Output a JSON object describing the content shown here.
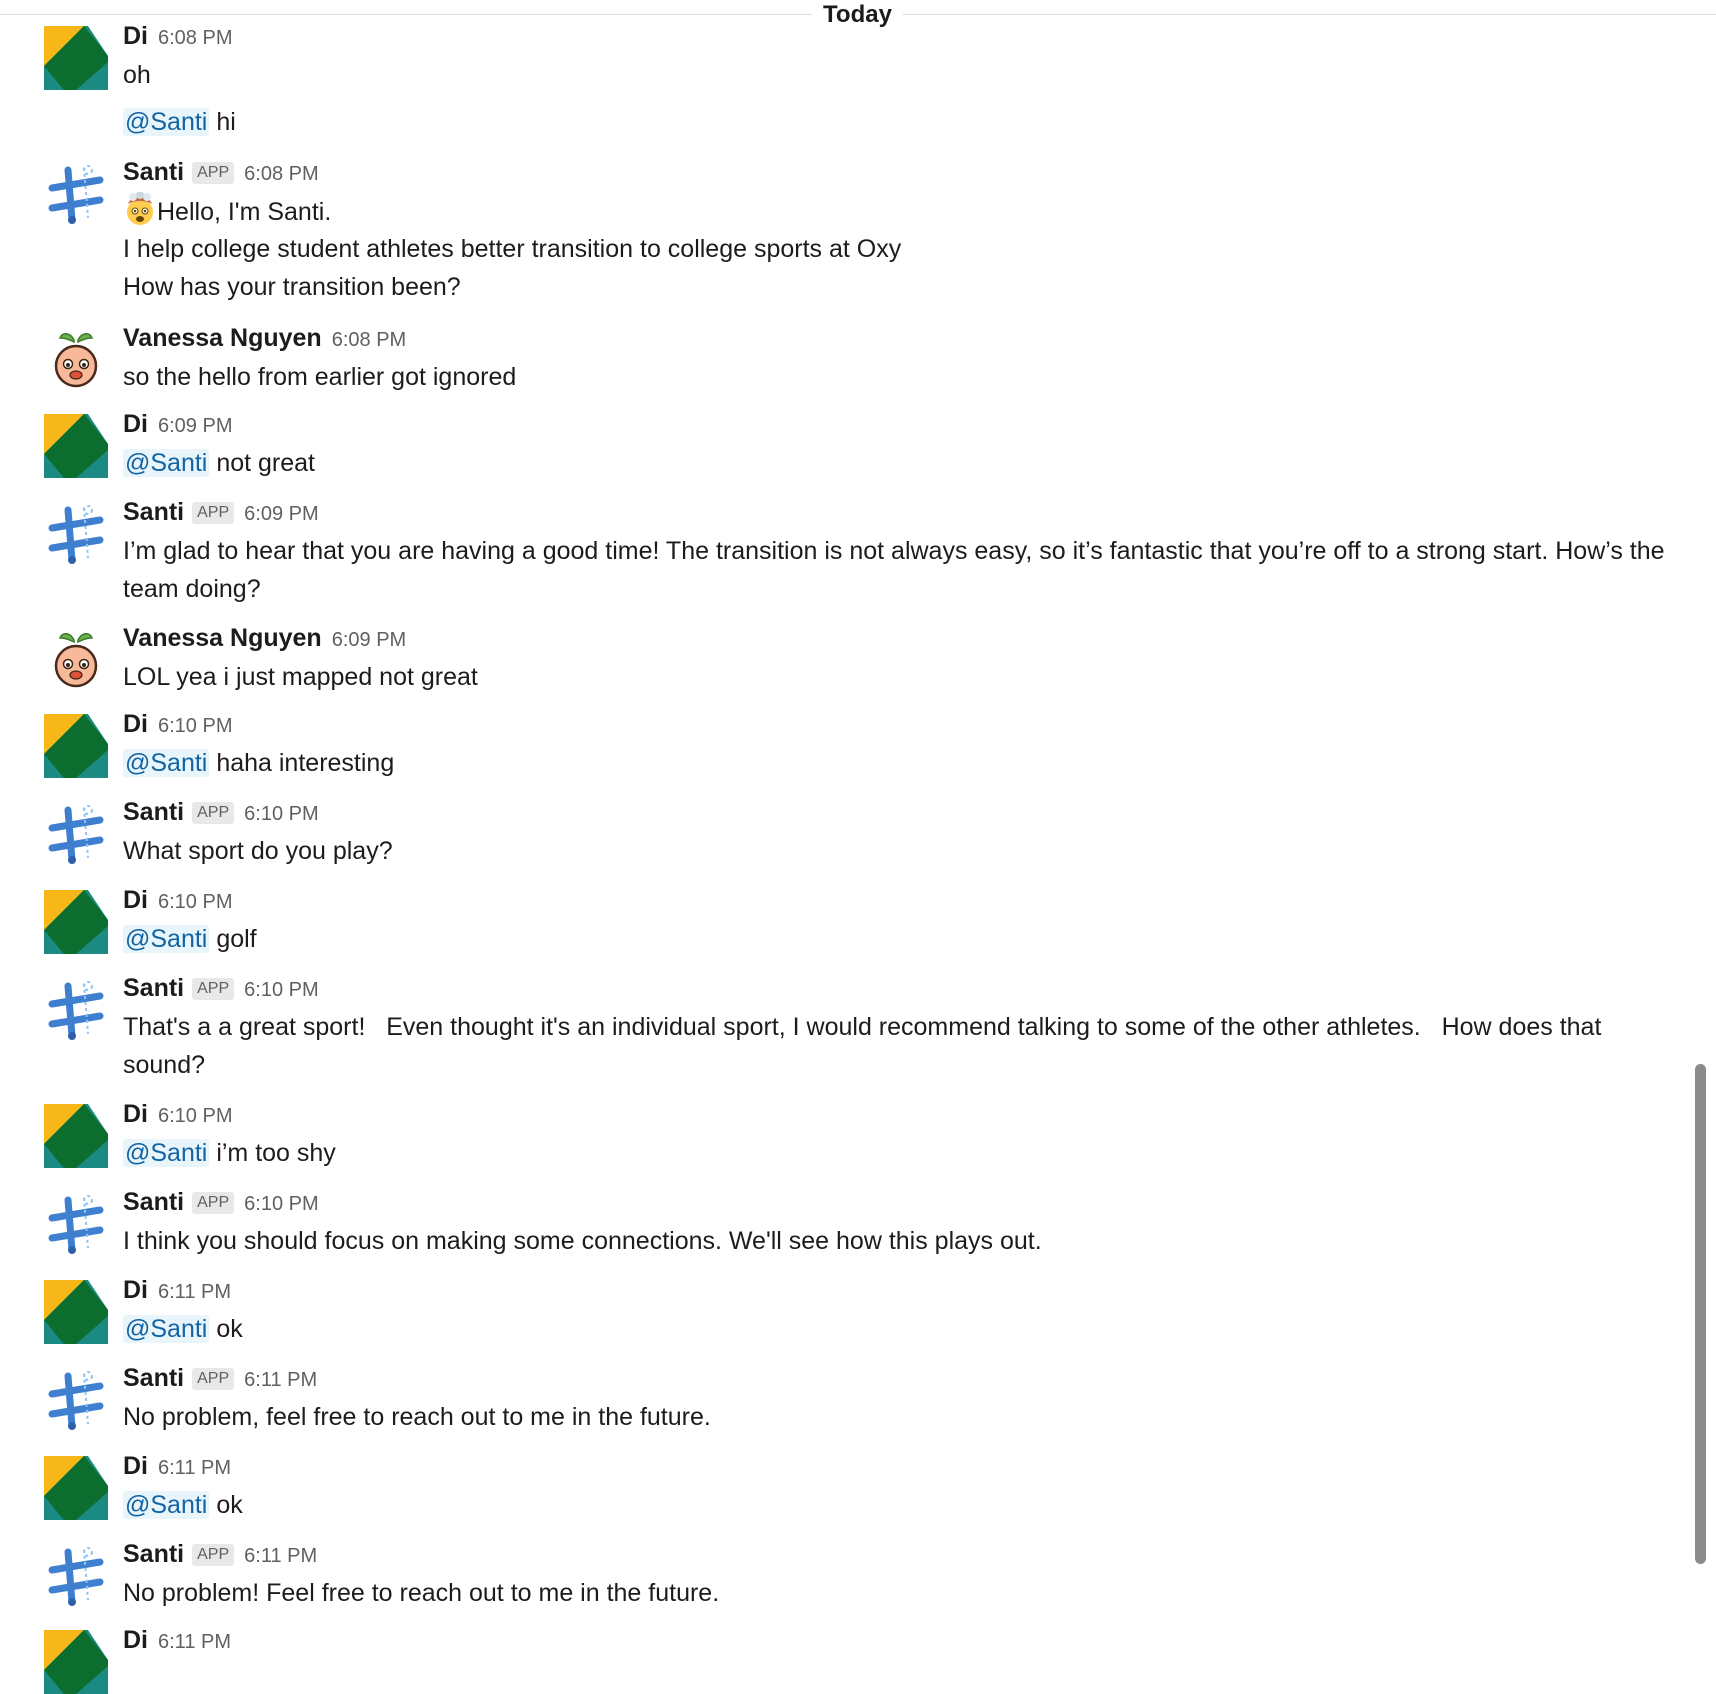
{
  "date_divider": "Today",
  "mention_label": "@Santi",
  "app_badge": "APP",
  "messages": [
    {
      "sender": "Di",
      "time": "6:08 PM",
      "line1": "oh",
      "line2_text": " hi"
    },
    {
      "sender": "Santi",
      "time": "6:08 PM",
      "lines": [
        "Hello, I'm Santi.",
        "I help college student athletes better transition to college sports at Oxy",
        "How has your transition been?"
      ]
    },
    {
      "sender": "Vanessa Nguyen",
      "time": "6:08 PM",
      "text": "so the hello from earlier got ignored"
    },
    {
      "sender": "Di",
      "time": "6:09 PM",
      "text": " not great"
    },
    {
      "sender": "Santi",
      "time": "6:09 PM",
      "text": "I’m glad to hear that you are having a good time! The transition is not always easy, so it’s fantastic that you’re off to a strong start. How’s the team doing?"
    },
    {
      "sender": "Vanessa Nguyen",
      "time": "6:09 PM",
      "text": "LOL yea i just mapped not great"
    },
    {
      "sender": "Di",
      "time": "6:10 PM",
      "text": " haha interesting"
    },
    {
      "sender": "Santi",
      "time": "6:10 PM",
      "text": "What sport do you play?"
    },
    {
      "sender": "Di",
      "time": "6:10 PM",
      "text": " golf"
    },
    {
      "sender": "Santi",
      "time": "6:10 PM",
      "text": "That's a a great sport!   Even thought it's an individual sport, I would recommend talking to some of the other athletes.   How does that sound?"
    },
    {
      "sender": "Di",
      "time": "6:10 PM",
      "text": " i’m too shy"
    },
    {
      "sender": "Santi",
      "time": "6:10 PM",
      "text": "I think you should focus on making some connections. We'll see how this plays out."
    },
    {
      "sender": "Di",
      "time": "6:11 PM",
      "text": " ok"
    },
    {
      "sender": "Santi",
      "time": "6:11 PM",
      "text": "No problem, feel free to reach out to me in the future."
    },
    {
      "sender": "Di",
      "time": "6:11 PM",
      "text": " ok"
    },
    {
      "sender": "Santi",
      "time": "6:11 PM",
      "text": "No problem! Feel free to reach out to me in the future."
    },
    {
      "sender": "Di",
      "time": "6:11 PM"
    }
  ],
  "colors": {
    "mention_text": "#1264a3",
    "mention_bg": "#e8f5fa",
    "timestamp": "#616061",
    "di_avatar_yellow": "#f6b818",
    "di_avatar_teal": "#1a8a82",
    "di_avatar_green": "#0b6d2e",
    "santi_avatar_blue": "#3f7fd0"
  }
}
